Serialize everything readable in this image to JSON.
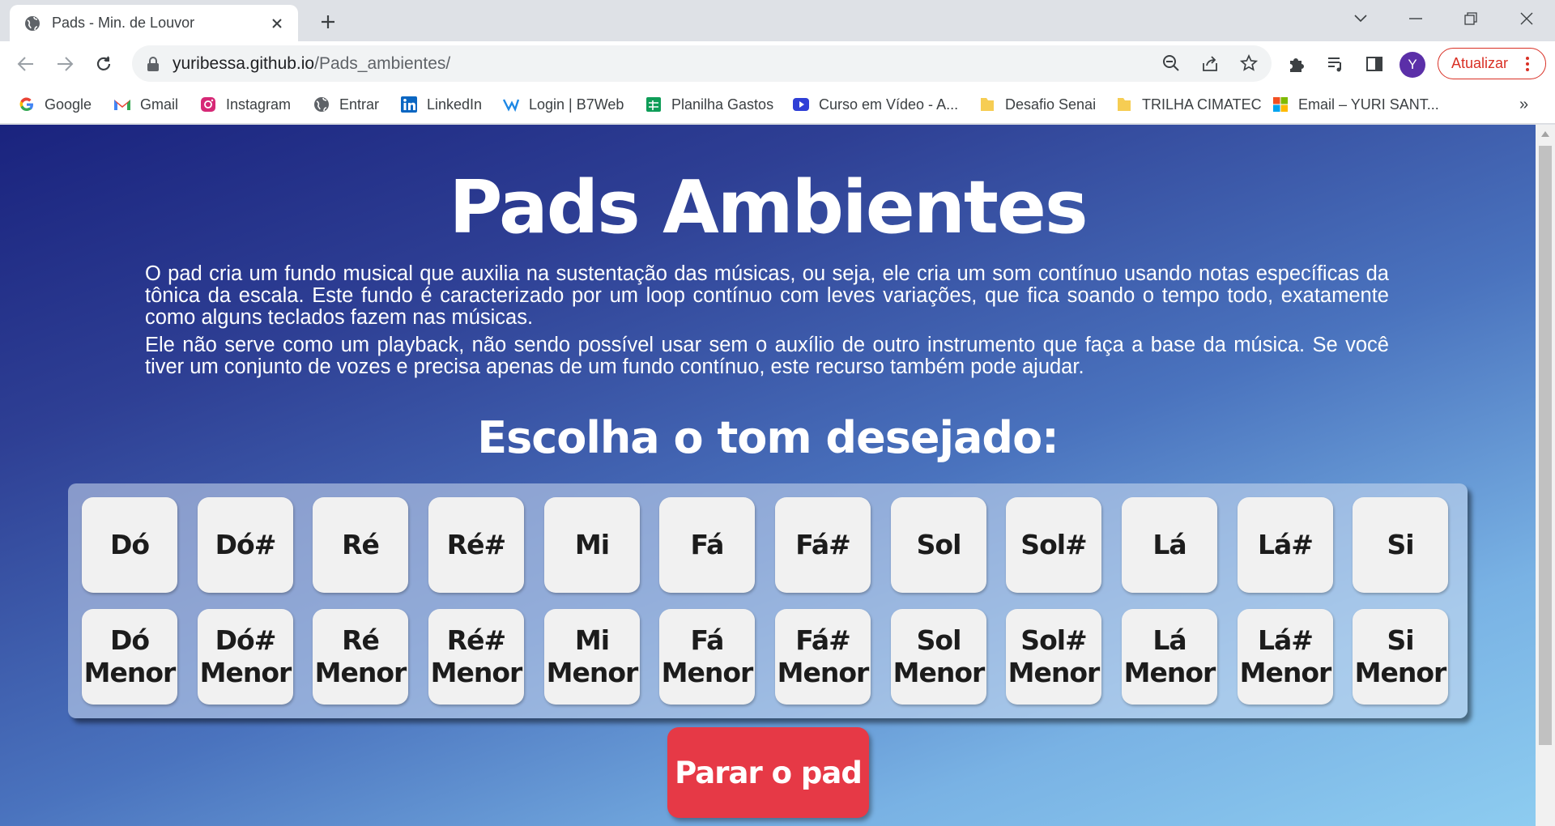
{
  "browser": {
    "tab_title": "Pads - Min. de Louvor",
    "url_host": "yuribessa.github.io",
    "url_path": "/Pads_ambientes/",
    "avatar_letter": "Y",
    "update_label": "Atualizar"
  },
  "bookmarks": [
    {
      "label": "Google",
      "icon": "google-icon"
    },
    {
      "label": "Gmail",
      "icon": "gmail-icon"
    },
    {
      "label": "Instagram",
      "icon": "instagram-icon"
    },
    {
      "label": "Entrar",
      "icon": "globe-icon"
    },
    {
      "label": "LinkedIn",
      "icon": "linkedin-icon"
    },
    {
      "label": "Login | B7Web",
      "icon": "b7web-icon"
    },
    {
      "label": "Planilha Gastos",
      "icon": "sheets-icon"
    },
    {
      "label": "Curso em Vídeo - A...",
      "icon": "curso-em-video-icon"
    },
    {
      "label": "Desafio Senai",
      "icon": "folder-icon"
    },
    {
      "label": "TRILHA CIMATEC",
      "icon": "folder-icon"
    },
    {
      "label": "Email – YURI SANT...",
      "icon": "microsoft-icon"
    }
  ],
  "page": {
    "title": "Pads Ambientes",
    "intro_1": "O pad cria um fundo musical que auxilia na sustentação das músicas, ou seja, ele cria um som contínuo usando notas específicas da tônica da escala. Este fundo é caracterizado por um loop contínuo com leves variações, que fica soando o tempo todo, exatamente como alguns teclados fazem nas músicas.",
    "intro_2": "Ele não serve como um playback, não sendo possível usar sem o auxílio de outro instrumento que faça a base da música. Se você tiver um conjunto de vozes e precisa apenas de um fundo contínuo, este recurso também pode ajudar.",
    "choose_title": "Escolha o tom desejado:",
    "major_keys": [
      "Dó",
      "Dó#",
      "Ré",
      "Ré#",
      "Mi",
      "Fá",
      "Fá#",
      "Sol",
      "Sol#",
      "Lá",
      "Lá#",
      "Si"
    ],
    "minor_suffix": "Menor",
    "stop_label": "Parar o pad"
  },
  "colors": {
    "gradient_start": "#1a237e",
    "gradient_end": "#8dccf0",
    "stop_button": "#e63946",
    "key_bg": "#f1f1f1"
  }
}
